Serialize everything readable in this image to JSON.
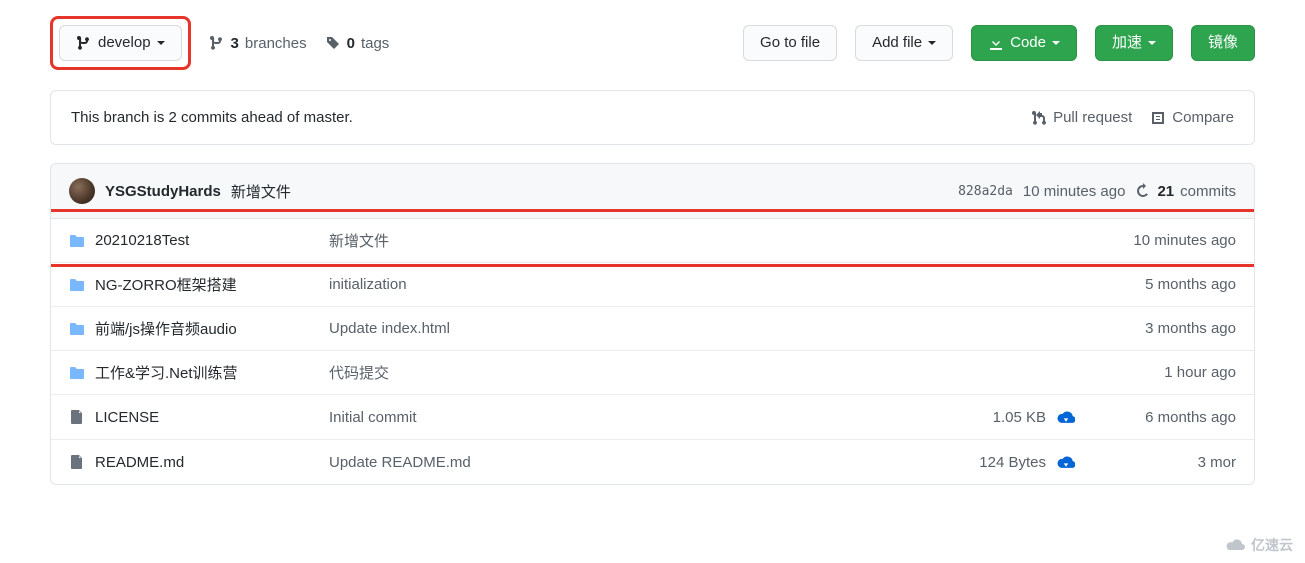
{
  "toolbar": {
    "branch_label": "develop",
    "branches_count": "3",
    "branches_text": "branches",
    "tags_count": "0",
    "tags_text": "tags",
    "go_to_file": "Go to file",
    "add_file": "Add file",
    "code": "Code",
    "accelerate": "加速",
    "mirror": "镜像"
  },
  "notice": {
    "text": "This branch is 2 commits ahead of master.",
    "pull_request": "Pull request",
    "compare": "Compare"
  },
  "header": {
    "author": "YSGStudyHards",
    "message": "新增文件",
    "sha": "828a2da",
    "time": "10 minutes ago",
    "commits_count": "21",
    "commits_text": "commits"
  },
  "rows": [
    {
      "type": "folder",
      "name": "20210218Test",
      "msg": "新增文件",
      "size": "",
      "download": false,
      "time": "10 minutes ago"
    },
    {
      "type": "folder",
      "name": "NG-ZORRO框架搭建",
      "msg": "initialization",
      "size": "",
      "download": false,
      "time": "5 months ago"
    },
    {
      "type": "folder",
      "name": "前端/js操作音频audio",
      "msg": "Update index.html",
      "size": "",
      "download": false,
      "time": "3 months ago"
    },
    {
      "type": "folder",
      "name": "工作&学习.Net训练营",
      "msg": "代码提交",
      "size": "",
      "download": false,
      "time": "1 hour ago"
    },
    {
      "type": "file",
      "name": "LICENSE",
      "msg": "Initial commit",
      "size": "1.05 KB",
      "download": true,
      "time": "6 months ago"
    },
    {
      "type": "file",
      "name": "README.md",
      "msg": "Update README.md",
      "size": "124 Bytes",
      "download": true,
      "time": "3 mor"
    }
  ],
  "watermark": "亿速云"
}
